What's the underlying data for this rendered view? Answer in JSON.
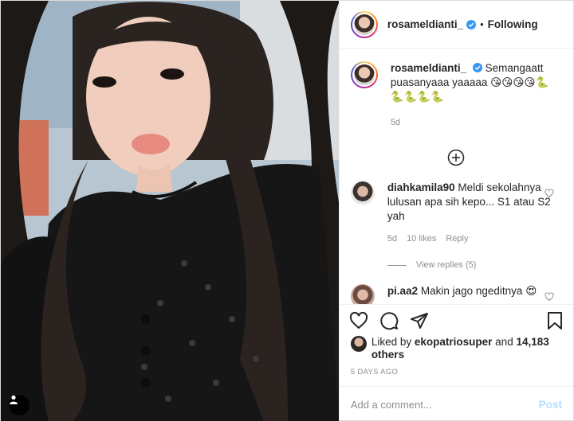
{
  "post": {
    "username": "rosameldianti_",
    "separator": "•",
    "follow_status": "Following",
    "caption": {
      "username": "rosameldianti_",
      "text": "Semangaatt puasanyaaa yaaaaa 😘😘😘😘🐍🐍🐍🐍🐍",
      "age": "5d"
    },
    "comments": [
      {
        "username": "diahkamila90",
        "text": "Meldi sekolahnya lulusan apa sih kepo... S1 atau S2 yah",
        "age": "5d",
        "likes": "10 likes",
        "reply_label": "Reply",
        "view_replies": "View replies (5)"
      },
      {
        "username": "pi.aa2",
        "text": "Makin jago ngeditnya 😍"
      }
    ],
    "liked_by_prefix": "Liked by",
    "liked_by_user": "ekopatriosuper",
    "liked_by_and": "and",
    "liked_by_others": "14,183 others",
    "post_age": "5 DAYS AGO",
    "comment_placeholder": "Add a comment...",
    "post_button": "Post"
  },
  "icons": [
    "user-tag-icon",
    "verified-badge-icon",
    "add-circle-icon",
    "heart-icon",
    "comment-icon",
    "share-icon",
    "bookmark-icon"
  ],
  "colors": {
    "verified": "#3897f0",
    "post_button_disabled": "#b2dffc",
    "meta_gray": "#8e8e8e"
  }
}
